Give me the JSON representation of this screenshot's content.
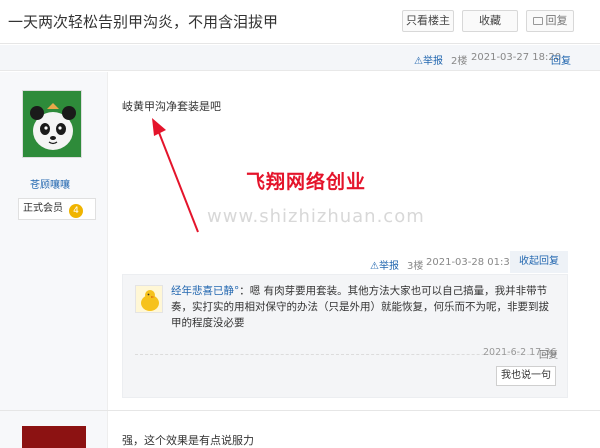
{
  "thread": {
    "title": "一天两次轻松告别甲沟炎，不用含泪拔甲",
    "only_host_label": "只看楼主",
    "favorite_label": "收藏",
    "reply_label": "回复"
  },
  "first_post": {
    "report_label": "举报",
    "floor": "2楼",
    "timestamp": "2021-03-27 18:20",
    "reply_link": "回复",
    "author": "苍顾嚷嚷",
    "rank": "正式会员",
    "rank_level": "4",
    "content": "岐黄甲沟净套装是吧"
  },
  "watermark": {
    "brand": "飞翔网络创业",
    "url": "www.shizhizhuan.com"
  },
  "sub_post": {
    "report_label": "举报",
    "floor": "3楼",
    "timestamp": "2021-03-28 01:36",
    "fold_reply_label": "收起回复"
  },
  "nested_reply": {
    "author": "经年悲喜已静°",
    "text": "：嗯 有肉芽要用套装。其他方法大家也可以自己搞量，我并非带节奏，实打实的用相对保守的办法（只是外用）就能恢复，何乐而不为呢，非要到拔甲的程度没必要",
    "timestamp": "2021-6-2 17:36",
    "reply_link": "回复",
    "say_button": "我也说一句"
  },
  "next_post": {
    "content": "强，这个效果是有点说服力"
  },
  "colors": {
    "link": "#2468b0",
    "watermark_red": "#e4142b",
    "badge": "#f0b400"
  }
}
